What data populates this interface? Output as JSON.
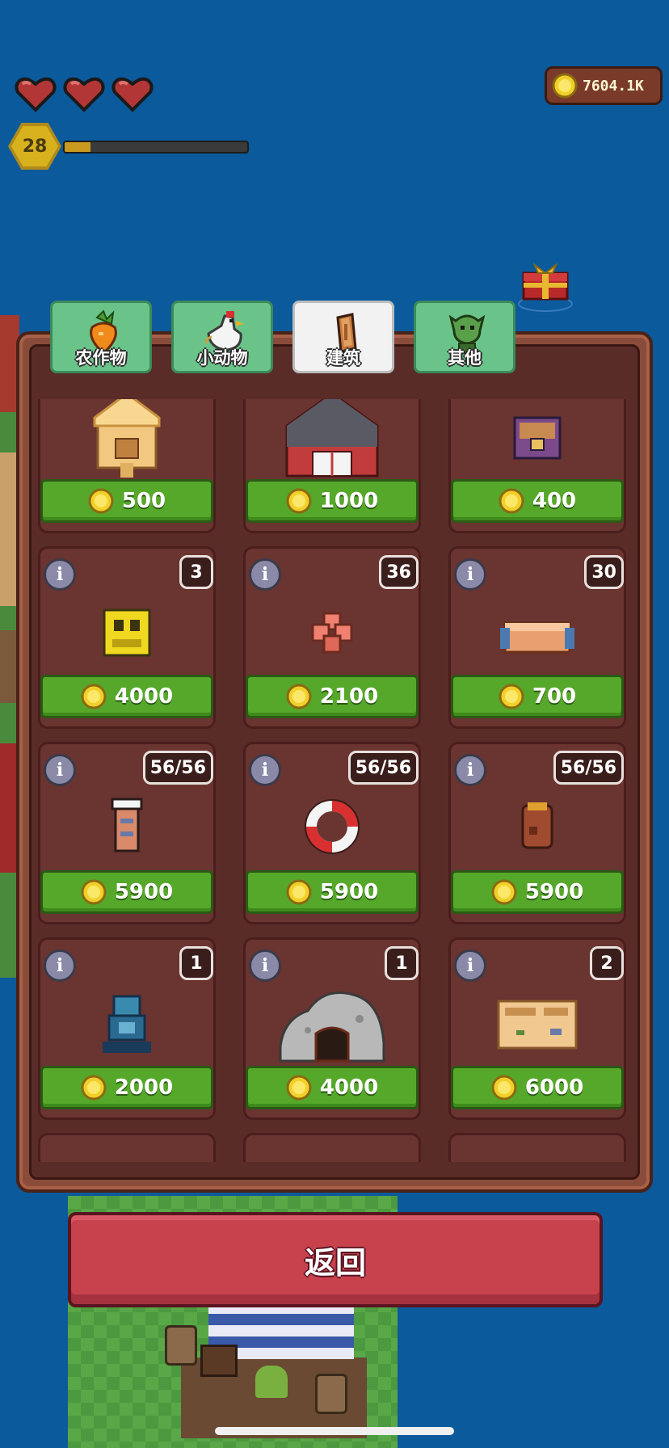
{
  "hud": {
    "hearts": [
      {
        "icon": "heart-icon",
        "filled": true
      },
      {
        "icon": "heart-icon",
        "filled": true
      },
      {
        "icon": "heart-icon",
        "filled": true
      }
    ],
    "level": "28",
    "xp_fraction": 0.14,
    "coins": "7604.1K"
  },
  "tabs": [
    {
      "label": "农作物",
      "icon": "carrot-icon",
      "active": false
    },
    {
      "label": "小动物",
      "icon": "chicken-icon",
      "active": false
    },
    {
      "label": "建筑",
      "icon": "wood-log-icon",
      "active": true
    },
    {
      "label": "其他",
      "icon": "goblin-icon",
      "active": false
    }
  ],
  "shop_items": [
    {
      "icon": "straw-house-icon",
      "price": "500",
      "count": ""
    },
    {
      "icon": "red-barn-icon",
      "price": "1000",
      "count": ""
    },
    {
      "icon": "storage-chest-icon",
      "price": "400",
      "count": ""
    },
    {
      "icon": "yellow-machine-icon",
      "price": "4000",
      "count": "3"
    },
    {
      "icon": "coral-flower-icon",
      "price": "2100",
      "count": "36"
    },
    {
      "icon": "wooden-bench-icon",
      "price": "700",
      "count": "30"
    },
    {
      "icon": "lighthouse-post-icon",
      "price": "5900",
      "count": "56/56"
    },
    {
      "icon": "lifebuoy-icon",
      "price": "5900",
      "count": "56/56"
    },
    {
      "icon": "backpack-icon",
      "price": "5900",
      "count": "56/56"
    },
    {
      "icon": "blue-robot-statue-icon",
      "price": "2000",
      "count": "1"
    },
    {
      "icon": "stone-cave-icon",
      "price": "4000",
      "count": "1"
    },
    {
      "icon": "workbench-icon",
      "price": "6000",
      "count": "2"
    }
  ],
  "back_button": "返回",
  "colors": {
    "accent_green": "#56a82a",
    "back_red": "#c8424e",
    "panel_brown": "#8a4c3a"
  }
}
